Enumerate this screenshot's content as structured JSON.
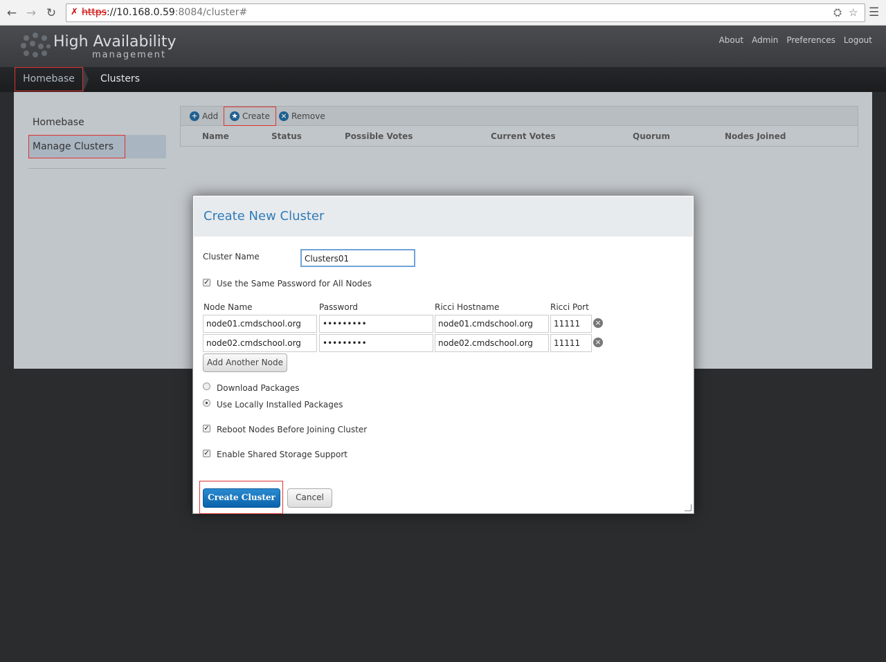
{
  "browser": {
    "url_protocol": "https",
    "url_rest_host": "://10.168.0.59",
    "url_rest_path": ":8084/cluster#"
  },
  "header": {
    "logo_title": "High Availability",
    "logo_subtitle": "management",
    "links": [
      "About",
      "Admin",
      "Preferences",
      "Logout"
    ]
  },
  "breadcrumb": {
    "home": "Homebase",
    "current": "Clusters"
  },
  "sidebar": {
    "items": [
      {
        "label": "Homebase"
      },
      {
        "label": "Manage Clusters"
      }
    ]
  },
  "toolbar": {
    "add": "Add",
    "create": "Create",
    "remove": "Remove"
  },
  "table": {
    "headers": [
      "Name",
      "Status",
      "Possible Votes",
      "Current Votes",
      "Quorum",
      "Nodes Joined"
    ]
  },
  "modal": {
    "title": "Create New Cluster",
    "cluster_name_label": "Cluster Name",
    "cluster_name_value": "Clusters01",
    "same_password_label": "Use the Same Password for All Nodes",
    "node_headers": [
      "Node Name",
      "Password",
      "Ricci Hostname",
      "Ricci Port"
    ],
    "nodes": [
      {
        "name": "node01.cmdschool.org",
        "password": "•••••••••",
        "hostname": "node01.cmdschool.org",
        "port": "11111"
      },
      {
        "name": "node02.cmdschool.org",
        "password": "•••••••••",
        "hostname": "node02.cmdschool.org",
        "port": "11111"
      }
    ],
    "add_node": "Add Another Node",
    "download_packages": "Download Packages",
    "use_local_packages": "Use Locally Installed Packages",
    "reboot_nodes": "Reboot Nodes Before Joining Cluster",
    "shared_storage": "Enable Shared Storage Support",
    "create_button": "Create Cluster",
    "cancel_button": "Cancel"
  },
  "colors": {
    "accent": "#2f7bb8",
    "highlight": "#dd3333"
  }
}
